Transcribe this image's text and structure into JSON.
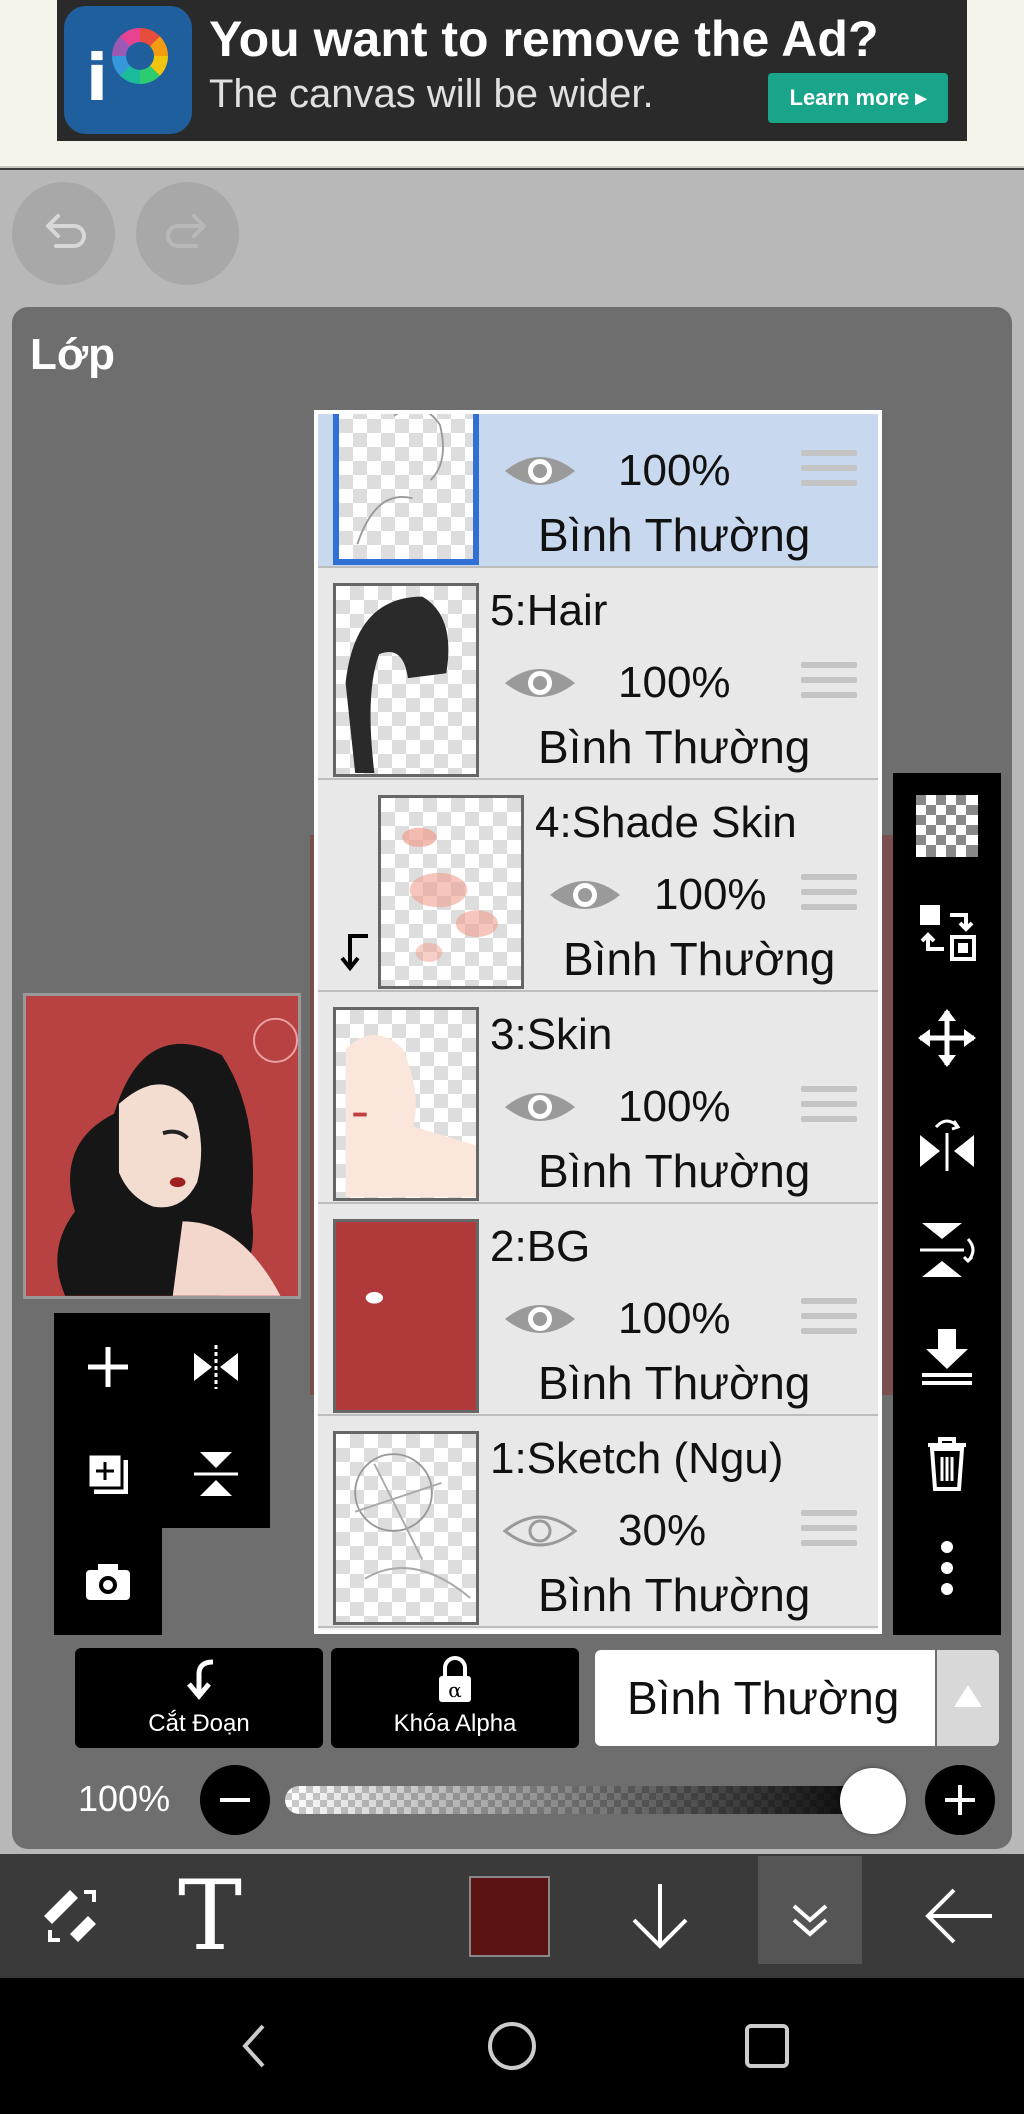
{
  "ad": {
    "title": "You want to remove the Ad?",
    "subtitle": "The canvas will be wider.",
    "button": "Learn more ▸"
  },
  "panel": {
    "title": "Lớp"
  },
  "layers": [
    {
      "name": "",
      "opacity": "100%",
      "mode": "Bình Thường",
      "selected": true
    },
    {
      "name": "5:Hair",
      "opacity": "100%",
      "mode": "Bình Thường"
    },
    {
      "name": "4:Shade Skin",
      "opacity": "100%",
      "mode": "Bình Thường",
      "clipped": true
    },
    {
      "name": "3:Skin",
      "opacity": "100%",
      "mode": "Bình Thường"
    },
    {
      "name": "2:BG",
      "opacity": "100%",
      "mode": "Bình Thường"
    },
    {
      "name": "1:Sketch (Ngu)",
      "opacity": "30%",
      "mode": "Bình Thường"
    }
  ],
  "controls": {
    "clip_label": "Cắt Đoạn",
    "alpha_lock_label": "Khóa Alpha",
    "blend_mode": "Bình Thường",
    "opacity_label": "100%",
    "opacity_value": 1.0
  },
  "colors": {
    "current_color": "#5a1212",
    "selected_layer": "#c8d8ee",
    "ad_button": "#19a58a"
  }
}
